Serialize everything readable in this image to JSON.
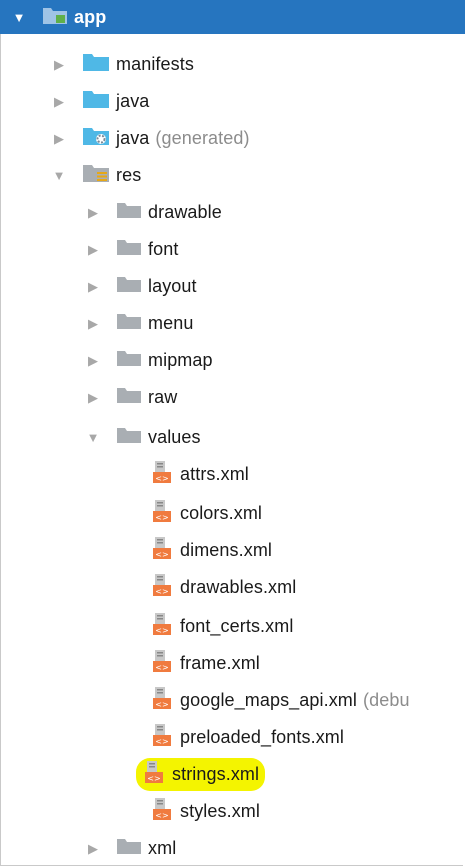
{
  "tree": {
    "root": {
      "label": "app",
      "expanded": true
    },
    "manifests": {
      "label": "manifests"
    },
    "java": {
      "label": "java"
    },
    "java_generated": {
      "label": "java",
      "suffix": "(generated)"
    },
    "res": {
      "label": "res",
      "expanded": true
    },
    "res_dirs": {
      "drawable": "drawable",
      "font": "font",
      "layout": "layout",
      "menu": "menu",
      "mipmap": "mipmap",
      "raw": "raw",
      "values": "values",
      "xml": "xml"
    },
    "values_files": {
      "attrs": "attrs.xml",
      "colors": "colors.xml",
      "dimens": "dimens.xml",
      "drawables": "drawables.xml",
      "font_certs": "font_certs.xml",
      "frame": "frame.xml",
      "google_maps_api": "google_maps_api.xml",
      "google_maps_api_suffix": "(debu",
      "preloaded_fonts": "preloaded_fonts.xml",
      "strings": "strings.xml",
      "styles": "styles.xml"
    }
  },
  "colors": {
    "selection": "#2675bf",
    "highlight": "#f4f400",
    "folder_blue": "#4fb8e6",
    "folder_gray": "#a9aeb3",
    "xml_orange": "#f07b3f"
  }
}
